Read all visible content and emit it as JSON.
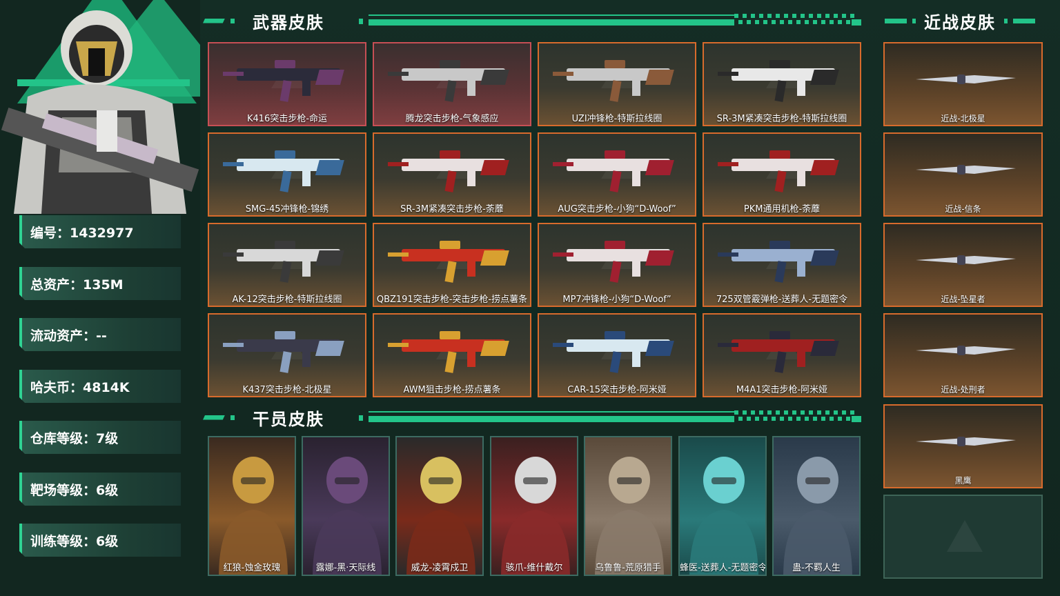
{
  "player": {
    "stats": [
      "编号：1432977",
      "总资产：135M",
      "流动资产：--",
      "哈夫币：4814K",
      "仓库等级：7级",
      "靶场等级：6级",
      "训练等级：6级"
    ]
  },
  "sections": {
    "weapons_title": "武器皮肤",
    "melee_title": "近战皮肤",
    "operators_title": "干员皮肤"
  },
  "weapons": [
    "K416突击步枪-命运",
    "腾龙突击步枪-气象感应",
    "UZI冲锋枪-特斯拉线圈",
    "SR-3M紧凑突击步枪-特斯拉线圈",
    "SMG-45冲锋枪-锦绣",
    "SR-3M紧凑突击步枪-荼蘼",
    "AUG突击步枪-小狗“D-Woof”",
    "PKM通用机枪-荼蘼",
    "AK-12突击步枪-特斯拉线圈",
    "QBZ191突击步枪-突击步枪-捞点薯条",
    "MP7冲锋枪-小狗“D-Woof”",
    "725双管霰弹枪-送葬人-无题密令",
    "K437突击步枪-北极星",
    "AWM狙击步枪-捞点薯条",
    "CAR-15突击步枪-阿米娅",
    "M4A1突击步枪-阿米娅"
  ],
  "melee": [
    "近战-北极星",
    "近战-信条",
    "近战-坠星者",
    "近战-处刑者",
    "黑鹰"
  ],
  "operators": [
    "红狼-蚀金玫瑰",
    "露娜-黑·天际线",
    "威龙-凌霄戍卫",
    "骇爪-维什戴尔",
    "乌鲁鲁-荒原猎手",
    "蜂医-送葬人-无题密令",
    "蛊-不羁人生"
  ],
  "colors": {
    "accent": "#23c489",
    "card_border": "#d86b2c",
    "background": "#132a22"
  }
}
